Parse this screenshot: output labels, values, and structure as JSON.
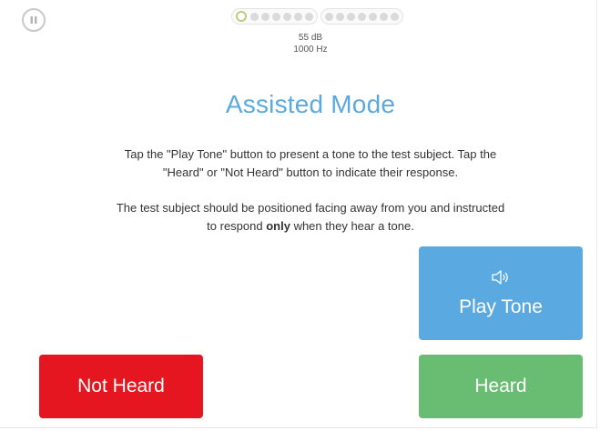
{
  "header": {
    "pause_icon": "pause-icon",
    "progress": {
      "group1_dots": 7,
      "group2_dots": 7,
      "active_index": 0
    },
    "level_db": "55 dB",
    "level_hz": "1000 Hz"
  },
  "main": {
    "title": "Assisted Mode",
    "instructions_1_line1": "Tap the \"Play Tone\" button to present a tone to the test subject. Tap the",
    "instructions_1_line2": "\"Heard\" or \"Not Heard\" button to indicate their response.",
    "instructions_2_line1": "The test subject should be positioned facing away from you and instructed",
    "instructions_2_line2_pre": "to respond ",
    "instructions_2_line2_bold": "only",
    "instructions_2_line2_post": " when they hear a tone."
  },
  "buttons": {
    "play_tone_icon": "speaker-icon",
    "play_tone_label": "Play Tone",
    "not_heard_label": "Not Heard",
    "heard_label": "Heard"
  },
  "colors": {
    "accent_blue": "#5aa9e0",
    "not_heard_red": "#e5161f",
    "heard_green": "#68bd73",
    "active_dot": "#b9cf7a"
  }
}
